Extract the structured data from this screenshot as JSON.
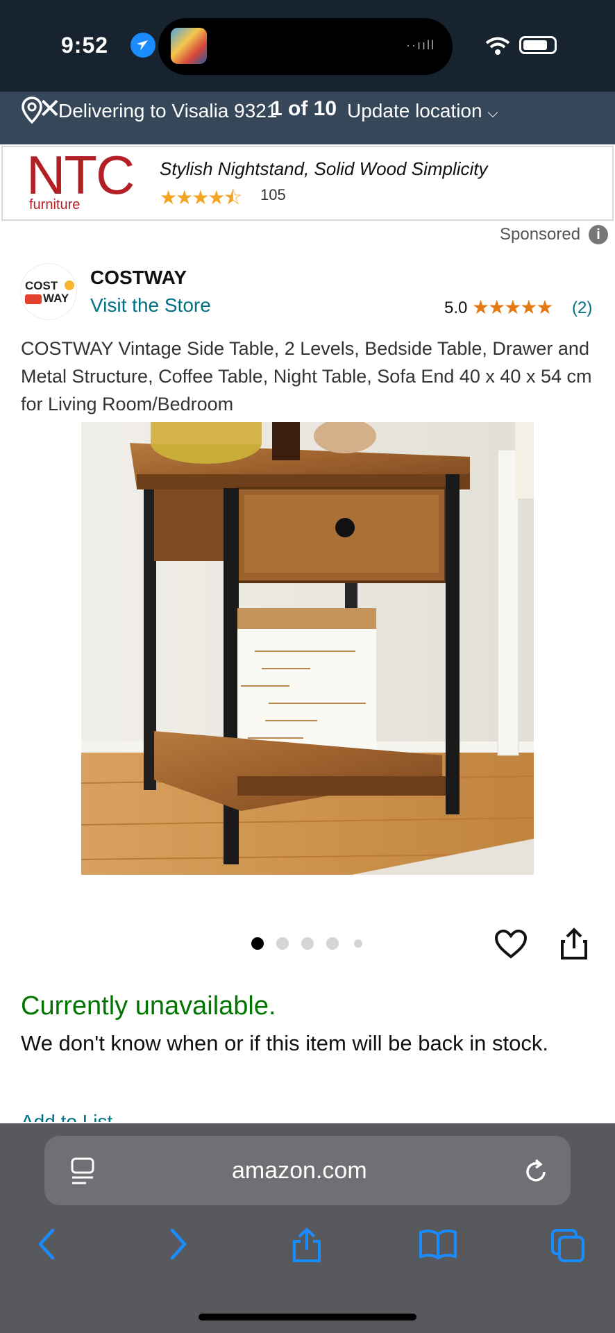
{
  "status_bar": {
    "time": "9:52"
  },
  "delivery": {
    "text": "Delivering to Visalia 9321",
    "update_label": "Update location",
    "photo_counter": "1 of 10"
  },
  "ad": {
    "brand_logo_text": "NTC",
    "brand_logo_subtext": "furniture",
    "title": "Stylish Nightstand, Solid Wood Simplicity",
    "stars_text": "★★★★⯪",
    "rating_count": "105",
    "sponsored_label": "Sponsored",
    "info_symbol": "i"
  },
  "brand": {
    "logo_cost": "COST",
    "logo_way": "WAY",
    "name": "COSTWAY",
    "visit_store": "Visit the Store",
    "rating_value": "5.0",
    "rating_stars": "★★★★★",
    "rating_count": "(2)"
  },
  "product": {
    "title": "COSTWAY Vintage Side Table, 2 Levels, Bedside Table, Drawer and Metal Structure, Coffee Table, Night Table, Sofa End 40 x 40 x 54 cm for Living Room/Bedroom",
    "image_alt": "Rustic brown side table with drawer and black metal frame",
    "carousel": {
      "current_index": 0,
      "count": 5
    }
  },
  "availability": {
    "status": "Currently unavailable.",
    "note": "We don't know when or if this item will be back in stock.",
    "add_to_list": "Add to List"
  },
  "browser": {
    "url": "amazon.com"
  },
  "colors": {
    "status_bar_bg": "#17232f",
    "delivery_bar_bg": "#37475a",
    "link": "#007185",
    "availability": "#007600",
    "rating_star": "#e47911",
    "browser_bg": "#57595c",
    "toolbar_icon": "#1a8cff"
  },
  "icons": [
    "location-arrow-icon",
    "location-pin-icon",
    "close-icon",
    "info-icon",
    "heart-icon",
    "share-icon",
    "reader-icon",
    "reload-icon",
    "back-icon",
    "forward-icon",
    "share-sheet-icon",
    "bookmarks-icon",
    "tabs-icon"
  ]
}
